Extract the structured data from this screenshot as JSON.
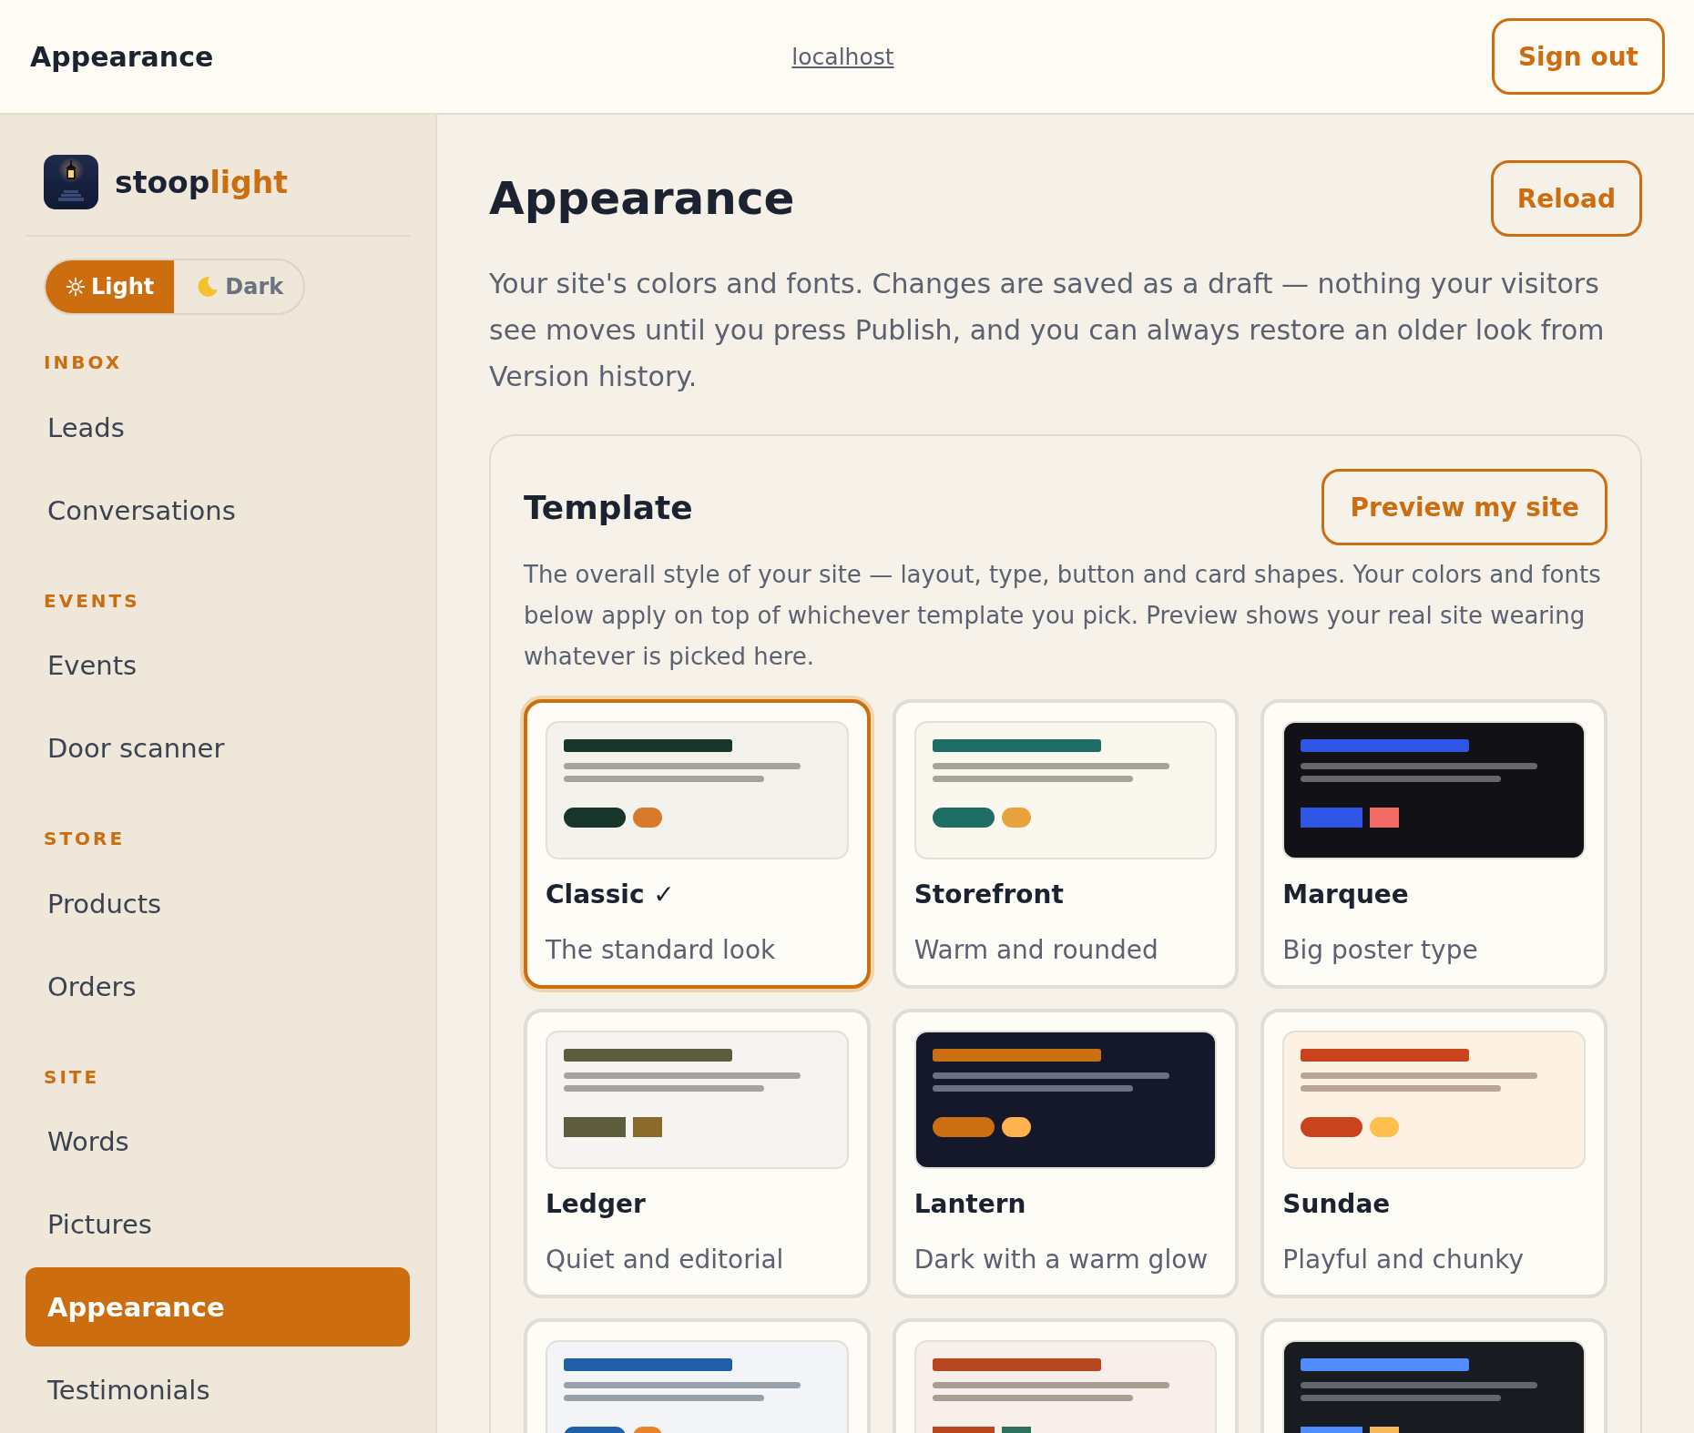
{
  "header": {
    "title": "Appearance",
    "link": "localhost",
    "sign_out": "Sign out"
  },
  "sidebar": {
    "brand": {
      "dark": "stoop",
      "accent": "light"
    },
    "theme_toggle": [
      {
        "label": "Light",
        "kind": "sun",
        "selected": true
      },
      {
        "label": "Dark",
        "kind": "moon",
        "selected": false
      }
    ],
    "sections": [
      {
        "label": "INBOX",
        "items": [
          {
            "label": "Leads",
            "selected": false
          },
          {
            "label": "Conversations",
            "selected": false
          }
        ]
      },
      {
        "label": "EVENTS",
        "items": [
          {
            "label": "Events",
            "selected": false
          },
          {
            "label": "Door scanner",
            "selected": false
          }
        ]
      },
      {
        "label": "STORE",
        "items": [
          {
            "label": "Products",
            "selected": false
          },
          {
            "label": "Orders",
            "selected": false
          }
        ]
      },
      {
        "label": "SITE",
        "items": [
          {
            "label": "Words",
            "selected": false
          },
          {
            "label": "Pictures",
            "selected": false
          },
          {
            "label": "Appearance",
            "selected": true
          },
          {
            "label": "Testimonials",
            "selected": false
          }
        ]
      }
    ]
  },
  "page": {
    "title": "Appearance",
    "reload": "Reload",
    "description": "Your site's colors and fonts. Changes are saved as a draft — nothing your visitors see moves until you press Publish, and you can always restore an older look from Version history."
  },
  "template": {
    "title": "Template",
    "preview_button": "Preview my site",
    "description": "The overall style of your site — layout, type, button and card shapes. Your colors and fonts below apply on top of whichever template you pick. Preview shows your real site wearing whatever is picked here.",
    "options": [
      {
        "name": "Classic ✓",
        "subtitle": "The standard look",
        "selected": true,
        "preview": {
          "kind": "pills",
          "ground": {
            "color": "#f4f2ec"
          },
          "heading": {
            "color": "#17352b"
          },
          "lines": {
            "color": "#a6a39a"
          },
          "buttons": [
            {
              "color": "#17352b"
            },
            {
              "color": "#d97a2b"
            }
          ]
        }
      },
      {
        "name": "Storefront",
        "subtitle": "Warm and rounded",
        "selected": false,
        "preview": {
          "kind": "pills",
          "ground": {
            "color": "#faf7ef"
          },
          "heading": {
            "color": "#1f6e63"
          },
          "lines": {
            "color": "#a6a39a"
          },
          "buttons": [
            {
              "color": "#1f6e63"
            },
            {
              "color": "#e8a33d"
            }
          ]
        }
      },
      {
        "name": "Marquee",
        "subtitle": "Big poster type",
        "selected": false,
        "preview": {
          "kind": "squares",
          "ground": {
            "color": "#111116"
          },
          "heading": {
            "color": "#2f55e6"
          },
          "lines": {
            "color": "#66666e"
          },
          "buttons": [
            {
              "color": "#2f55e6"
            },
            {
              "color": "#f26b66"
            }
          ]
        }
      },
      {
        "name": "Ledger",
        "subtitle": "Quiet and editorial",
        "selected": false,
        "preview": {
          "kind": "squares",
          "ground": {
            "color": "#f5f4f0"
          },
          "heading": {
            "color": "#5d5d3d"
          },
          "lines": {
            "color": "#a6a39e"
          },
          "buttons": [
            {
              "color": "#5d5d3d"
            },
            {
              "color": "#8a6b2c"
            }
          ]
        }
      },
      {
        "name": "Lantern",
        "subtitle": "Dark with a warm glow",
        "selected": false,
        "preview": {
          "kind": "pills",
          "ground": {
            "color": "#15182b"
          },
          "heading": {
            "color": "#cc6f12"
          },
          "lines": {
            "color": "#6b7084"
          },
          "buttons": [
            {
              "color": "#cc6f12"
            },
            {
              "color": "#fdb24e"
            }
          ]
        }
      },
      {
        "name": "Sundae",
        "subtitle": "Playful and chunky",
        "selected": false,
        "preview": {
          "kind": "pills",
          "ground": {
            "color": "#fdf1e4"
          },
          "heading": {
            "color": "#c9441e"
          },
          "lines": {
            "color": "#b8a598"
          },
          "buttons": [
            {
              "color": "#c9441e"
            },
            {
              "color": "#fdc04c"
            }
          ]
        }
      },
      {
        "selected": false,
        "preview": {
          "kind": "pills",
          "ground": {
            "color": "#f2f4f8"
          },
          "heading": {
            "color": "#1f5fa8"
          },
          "lines": {
            "color": "#98a0aa"
          },
          "buttons": [
            {
              "color": "#1f5fa8"
            },
            {
              "color": "#e9832a"
            }
          ]
        }
      },
      {
        "selected": false,
        "preview": {
          "kind": "squares",
          "ground": {
            "color": "#f8efea"
          },
          "heading": {
            "color": "#b8461f"
          },
          "lines": {
            "color": "#aa9d92"
          },
          "buttons": [
            {
              "color": "#b8461f"
            },
            {
              "color": "#2f6f5e"
            }
          ]
        }
      },
      {
        "selected": false,
        "preview": {
          "kind": "squares",
          "ground": {
            "color": "#181b20"
          },
          "heading": {
            "color": "#4f8cff"
          },
          "lines": {
            "color": "#62666e"
          },
          "buttons": [
            {
              "color": "#4f8cff"
            },
            {
              "color": "#f3b85a"
            }
          ]
        }
      }
    ]
  }
}
